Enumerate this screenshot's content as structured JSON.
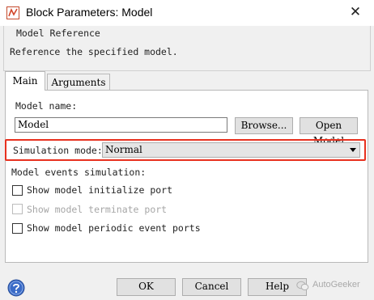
{
  "window": {
    "title": "Block Parameters: Model",
    "close_glyph": "✕"
  },
  "group": {
    "title": "Model Reference",
    "description": "Reference the specified model."
  },
  "tabs": [
    {
      "label": "Main",
      "selected": true
    },
    {
      "label": "Arguments",
      "selected": false
    }
  ],
  "main": {
    "model_name_label": "Model name:",
    "model_name_value": "Model",
    "browse_label": "Browse...",
    "open_model_label": "Open Model",
    "simulation_mode_label": "Simulation mode:",
    "simulation_mode_value": "Normal",
    "events_label": "Model events simulation:",
    "checkboxes": [
      {
        "label": "Show model initialize port",
        "checked": false,
        "enabled": true
      },
      {
        "label": "Show model terminate port",
        "checked": false,
        "enabled": false
      },
      {
        "label": "Show model periodic event ports",
        "checked": false,
        "enabled": true
      }
    ]
  },
  "footer": {
    "ok_label": "OK",
    "cancel_label": "Cancel",
    "help_label": "Help",
    "help_icon": "question-icon"
  },
  "watermark": {
    "text": "AutoGeeker"
  },
  "colors": {
    "highlight": "#e8311f",
    "help_icon": "#3a6bc7"
  }
}
